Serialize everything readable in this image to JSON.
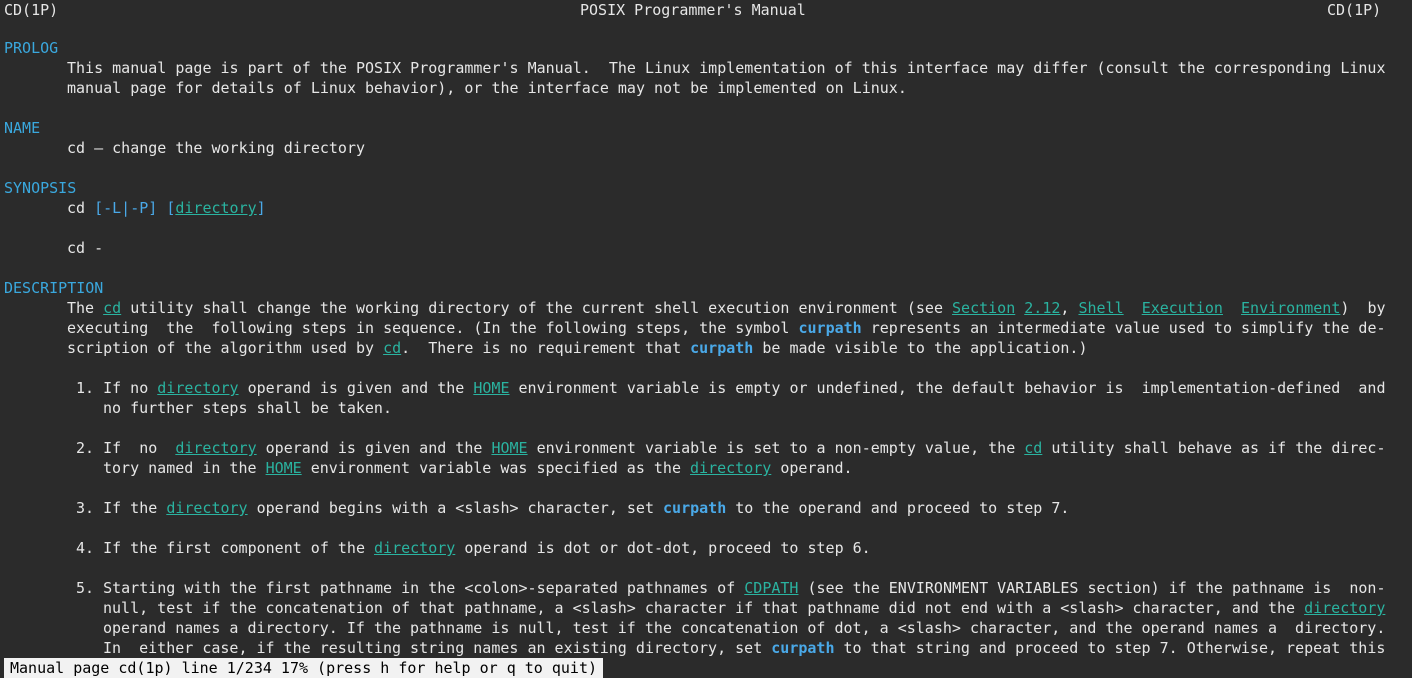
{
  "header": {
    "left": "CD(1P)",
    "center": "POSIX Programmer's Manual",
    "right": "CD(1P)"
  },
  "prolog": {
    "heading": "PROLOG",
    "line1": "This manual page is part of the POSIX Programmer's Manual.  The Linux implementation of this interface may differ (consult the corresponding Linux",
    "line2": "manual page for details of Linux behavior), or the interface may not be implemented on Linux."
  },
  "name": {
    "heading": "NAME",
    "line1": "cd — change the working directory"
  },
  "synopsis": {
    "heading": "SYNOPSIS",
    "l1a": "cd ",
    "l1b": "[-L|-P] ",
    "l1c": "[",
    "l1d": "directory",
    "l1e": "]",
    "l2": "cd -"
  },
  "description": {
    "heading": "DESCRIPTION",
    "p1a": "The ",
    "p1b": "cd",
    "p1c": " utility shall change the working directory of the current shell execution environment (see ",
    "p1d": "Section",
    "p1e": " ",
    "p1f": "2.12",
    "p1g": ", ",
    "p1h": "Shell",
    "p1i": "  ",
    "p1j": "Execution",
    "p1k": "  ",
    "p1l": "Environment",
    "p1m": ")  by",
    "p2a": "executing  the  following steps in sequence. (In the following steps, the symbol ",
    "p2b": "curpath",
    "p2c": " represents an intermediate value used to simplify the de-",
    "p3a": "scription of the algorithm used by ",
    "p3b": "cd",
    "p3c": ".  There is no requirement that ",
    "p3d": "curpath",
    "p3e": " be made visible to the application.)",
    "s1a": "1. If no ",
    "s1b": "directory",
    "s1c": " operand is given and the ",
    "s1d": "HOME",
    "s1e": " environment variable is empty or undefined, the default behavior is  implementation-defined  and",
    "s1f": "no further steps shall be taken.",
    "s2a": "2. If  no  ",
    "s2b": "directory",
    "s2c": " operand is given and the ",
    "s2d": "HOME",
    "s2e": " environment variable is set to a non-empty value, the ",
    "s2f": "cd",
    "s2g": " utility shall behave as if the direc-",
    "s2h": "tory named in the ",
    "s2i": "HOME",
    "s2j": " environment variable was specified as the ",
    "s2k": "directory",
    "s2l": " operand.",
    "s3a": "3. If the ",
    "s3b": "directory",
    "s3c": " operand begins with a <slash> character, set ",
    "s3d": "curpath",
    "s3e": " to the operand and proceed to step 7.",
    "s4a": "4. If the first component of the ",
    "s4b": "directory",
    "s4c": " operand is dot or dot-dot, proceed to step 6.",
    "s5a": "5. Starting with the first pathname in the <colon>-separated pathnames of ",
    "s5b": "CDPATH",
    "s5c": " (see the ENVIRONMENT VARIABLES section) if the pathname is  non-",
    "s5d": "null, test if the concatenation of that pathname, a <slash> character if that pathname did not end with a <slash> character, and the ",
    "s5e": "directory",
    "s5f": "operand names a directory. If the pathname is null, test if the concatenation of dot, a <slash> character, and the operand names a  directory.",
    "s5g": "In  either case, if the resulting string names an existing directory, set ",
    "s5h": "curpath",
    "s5i": " to that string and proceed to step 7. Otherwise, repeat this"
  },
  "status": "Manual page cd(1p) line 1/234 17% (press h for help or q to quit)"
}
